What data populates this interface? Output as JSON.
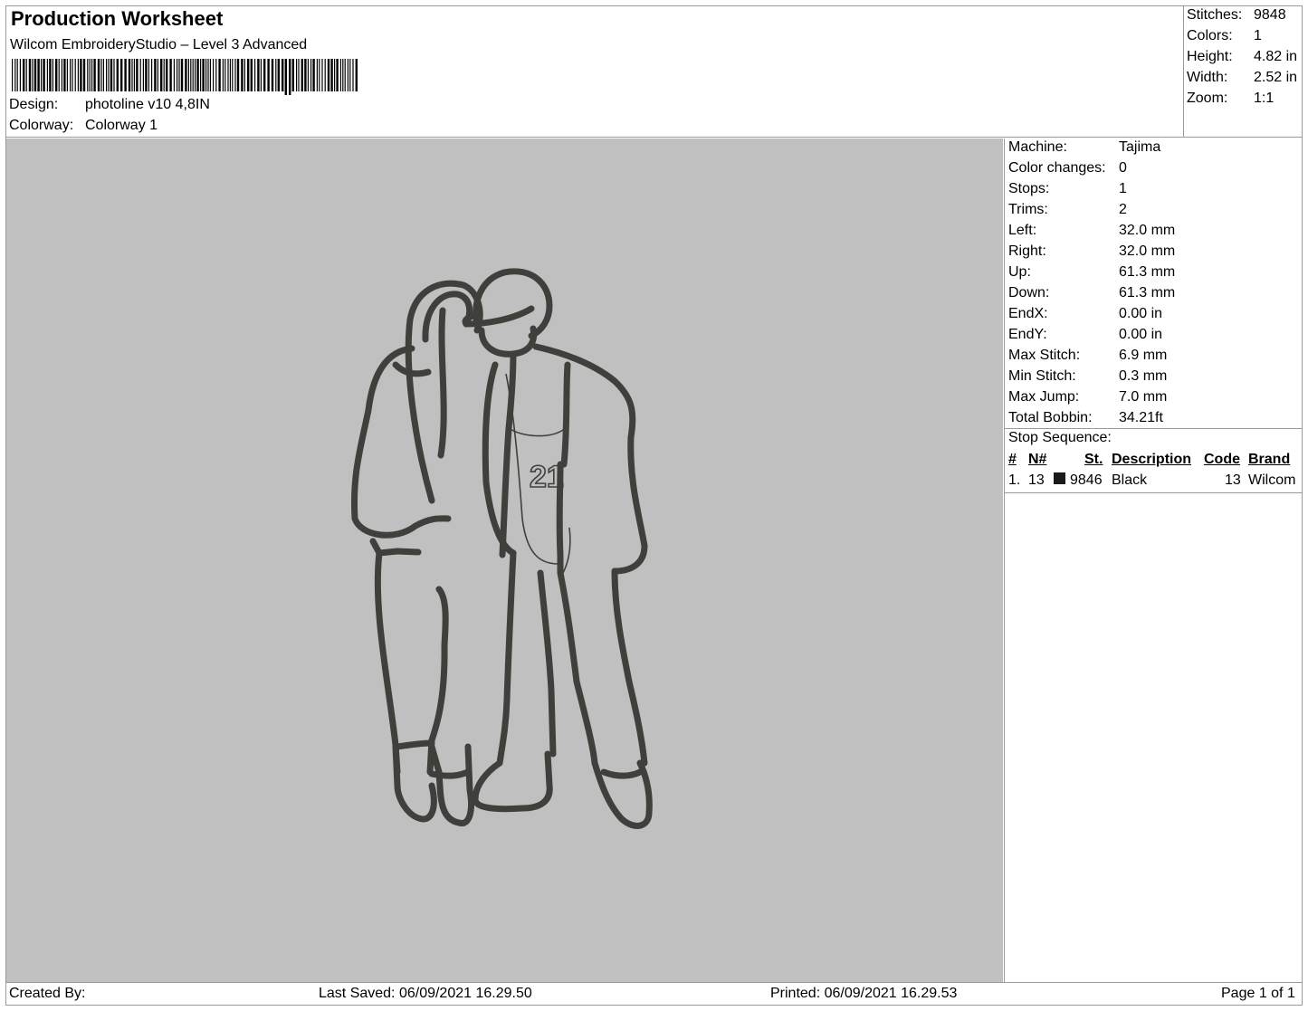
{
  "header": {
    "title": "Production Worksheet",
    "software": "Wilcom EmbroideryStudio – Level 3 Advanced",
    "design_label": "Design:",
    "design_value": "photoline v10 4,8IN",
    "colorway_label": "Colorway:",
    "colorway_value": "Colorway 1"
  },
  "summary": [
    {
      "label": "Stitches:",
      "value": "9848"
    },
    {
      "label": "Colors:",
      "value": "1"
    },
    {
      "label": "Height:",
      "value": "4.82 in"
    },
    {
      "label": "Width:",
      "value": "2.52 in"
    },
    {
      "label": "Zoom:",
      "value": "1:1"
    }
  ],
  "machine_info": [
    {
      "label": "Machine:",
      "value": "Tajima"
    },
    {
      "label": "Color changes:",
      "value": "0"
    },
    {
      "label": "Stops:",
      "value": "1"
    },
    {
      "label": "Trims:",
      "value": "2"
    },
    {
      "label": "Left:",
      "value": "32.0 mm"
    },
    {
      "label": "Right:",
      "value": "32.0 mm"
    },
    {
      "label": "Up:",
      "value": "61.3 mm"
    },
    {
      "label": "Down:",
      "value": "61.3 mm"
    },
    {
      "label": "EndX:",
      "value": "0.00 in"
    },
    {
      "label": "EndY:",
      "value": "0.00 in"
    },
    {
      "label": "Max Stitch:",
      "value": "6.9 mm"
    },
    {
      "label": "Min Stitch:",
      "value": "0.3 mm"
    },
    {
      "label": "Max Jump:",
      "value": "7.0 mm"
    },
    {
      "label": "Total Bobbin:",
      "value": "34.21ft"
    }
  ],
  "stop_sequence": {
    "title": "Stop Sequence:",
    "columns": {
      "num": "#",
      "needle": "N#",
      "stitches": "St.",
      "description": "Description",
      "code": "Code",
      "brand": "Brand"
    },
    "rows": [
      {
        "num": "1.",
        "needle": "13",
        "stitches": "9846",
        "description": "Black",
        "code": "13",
        "brand": "Wilcom",
        "color": "#1a1a1a"
      }
    ]
  },
  "footer": {
    "created": "Created By:",
    "last_saved": "Last Saved: 06/09/2021 16.29.50",
    "printed": "Printed: 06/09/2021 16.29.53",
    "page": "Page 1 of 1"
  },
  "design_preview": {
    "background": "#c0c0c0",
    "thread_color": "#3f3f3b",
    "jersey_number": "21"
  }
}
